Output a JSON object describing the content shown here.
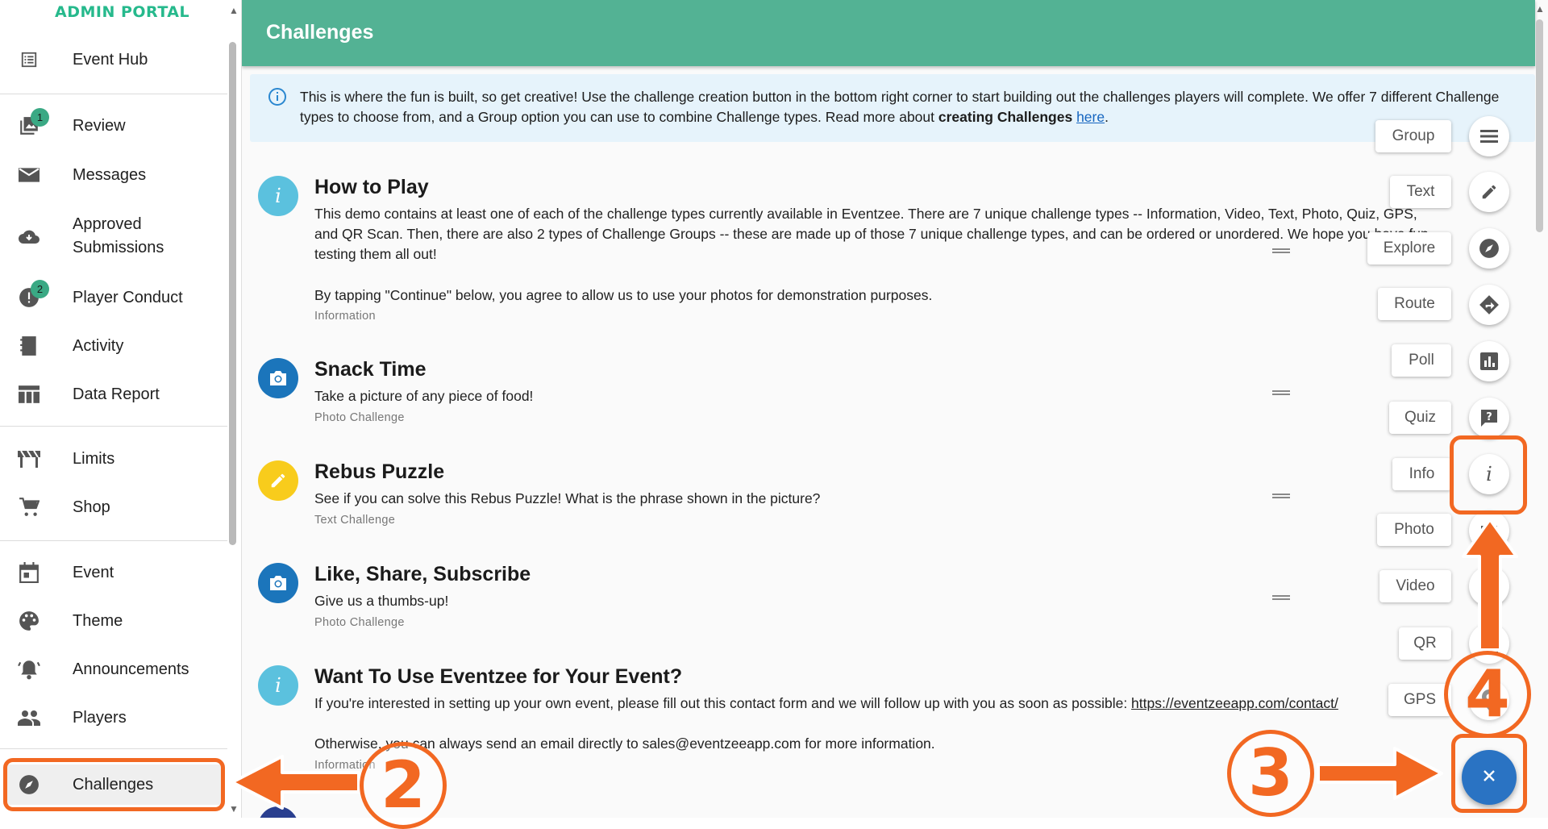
{
  "brand": "ADMIN PORTAL",
  "sidebar": {
    "items": [
      {
        "label": "Event Hub",
        "icon": "list-icon"
      },
      {
        "label": "Review",
        "icon": "photo-library-icon",
        "badge": "1"
      },
      {
        "label": "Messages",
        "icon": "mail-icon"
      },
      {
        "label": "Approved Submissions",
        "icon": "cloud-download-icon"
      },
      {
        "label": "Player Conduct",
        "icon": "alert-icon",
        "badge": "2"
      },
      {
        "label": "Activity",
        "icon": "notebook-icon"
      },
      {
        "label": "Data Report",
        "icon": "table-icon"
      },
      {
        "label": "Limits",
        "icon": "barrier-icon"
      },
      {
        "label": "Shop",
        "icon": "cart-icon"
      },
      {
        "label": "Event",
        "icon": "calendar-icon"
      },
      {
        "label": "Theme",
        "icon": "palette-icon"
      },
      {
        "label": "Announcements",
        "icon": "bell-icon"
      },
      {
        "label": "Players",
        "icon": "people-icon"
      },
      {
        "label": "Challenges",
        "icon": "compass-icon",
        "active": true
      }
    ]
  },
  "header": {
    "title": "Challenges"
  },
  "banner": {
    "text_before": "This is where the fun is built, so get creative! Use the challenge creation button in the bottom right corner to start building out the challenges players will complete. We offer 7 different Challenge types to choose from, and a Group option you can use to combine Challenge types. Read more about ",
    "bold_text": "creating Challenges",
    "link_text": "here",
    "text_after": "."
  },
  "challenges": [
    {
      "title": "How to Play",
      "description": "This demo contains at least one of each of the challenge types currently available in Eventzee. There are 7 unique challenge types -- Information, Video, Text, Photo, Quiz, GPS, and QR Scan. Then, there are also 2 types of Challenge Groups -- these are made up of those 7 unique challenge types, and can be ordered or unordered. We hope you have fun testing them all out!",
      "description2": "By tapping \"Continue\" below, you agree to allow us to use your photos for demonstration purposes.",
      "type": "Information",
      "icon": "info-icon"
    },
    {
      "title": "Snack Time",
      "description": "Take a picture of any piece of food!",
      "type": "Photo Challenge",
      "icon": "camera-icon"
    },
    {
      "title": "Rebus Puzzle",
      "description": "See if you can solve this Rebus Puzzle! What is the phrase shown in the picture?",
      "type": "Text Challenge",
      "icon": "pencil-icon"
    },
    {
      "title": "Like, Share, Subscribe",
      "description": "Give us a thumbs-up!",
      "type": "Photo Challenge",
      "icon": "camera-icon"
    },
    {
      "title": "Want To Use Eventzee for Your Event?",
      "description": "If you're interested in setting up your own event, please fill out this contact form and we will follow up with you as soon as possible: ",
      "link": "https://eventzeeapp.com/contact/",
      "description2": "Otherwise, you can always send an email directly to sales@eventzeeapp.com for more information.",
      "type": "Information",
      "icon": "info-icon"
    }
  ],
  "speed_dial": [
    {
      "label": "Group",
      "icon": "menu-icon"
    },
    {
      "label": "Text",
      "icon": "pencil-icon"
    },
    {
      "label": "Explore",
      "icon": "compass-icon"
    },
    {
      "label": "Route",
      "icon": "directions-icon"
    },
    {
      "label": "Poll",
      "icon": "chart-icon"
    },
    {
      "label": "Quiz",
      "icon": "question-icon"
    },
    {
      "label": "Info",
      "icon": "info-icon"
    },
    {
      "label": "Photo",
      "icon": "camera-icon"
    },
    {
      "label": "Video",
      "icon": "video-icon"
    },
    {
      "label": "QR",
      "icon": "qr-icon"
    },
    {
      "label": "GPS",
      "icon": "location-icon"
    }
  ],
  "fab": {
    "icon": "close-icon"
  },
  "annotations": [
    "2",
    "3",
    "4"
  ],
  "colors": {
    "header": "#53b294",
    "accent": "#f26822",
    "fab": "#2a73c3",
    "brand": "#26b98c"
  }
}
